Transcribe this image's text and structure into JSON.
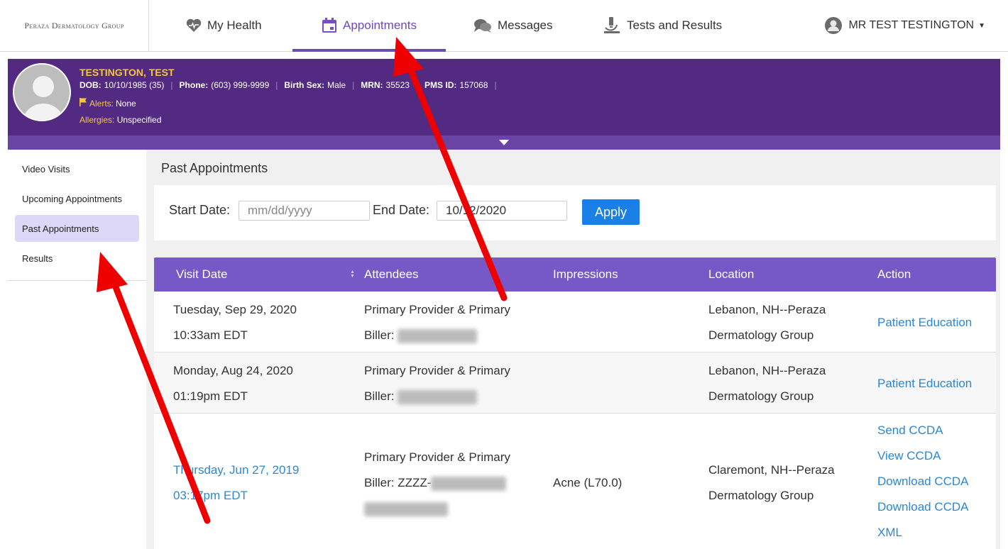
{
  "brand": "Peraza Dermatology Group",
  "nav": {
    "my_health": "My Health",
    "appointments": "Appointments",
    "messages": "Messages",
    "tests_results": "Tests and Results",
    "user": "MR TEST TESTINGTON"
  },
  "patient": {
    "name": "TESTINGTON, TEST",
    "dob_label": "DOB:",
    "dob": "10/10/1985 (35)",
    "phone_label": "Phone:",
    "phone": "(603) 999-9999",
    "sex_label": "Birth Sex:",
    "sex": "Male",
    "mrn_label": "MRN:",
    "mrn": "35523",
    "pms_label": "PMS ID:",
    "pms": "157068",
    "alerts_label": "Alerts:",
    "alerts": "None",
    "allergies_label": "Allergies:",
    "allergies": "Unspecified"
  },
  "sidebar": {
    "items": [
      {
        "label": "Video Visits"
      },
      {
        "label": "Upcoming Appointments"
      },
      {
        "label": "Past Appointments"
      },
      {
        "label": "Results"
      }
    ]
  },
  "main": {
    "title": "Past Appointments",
    "filter": {
      "start_label": "Start Date:",
      "start_placeholder": "mm/dd/yyyy",
      "start_value": "",
      "end_label": "End Date:",
      "end_value": "10/12/2020",
      "apply_label": "Apply"
    },
    "table": {
      "headers": [
        "Visit Date",
        "Attendees",
        "Impressions",
        "Location",
        "Action"
      ],
      "rows": [
        {
          "date": "Tuesday, Sep 29, 2020",
          "time": "10:33am EDT",
          "attendee_line1": "Primary Provider & Primary",
          "attendee_line2": "Biller:",
          "impressions": "",
          "location_line1": "Lebanon, NH--Peraza",
          "location_line2": "Dermatology Group",
          "actions": [
            "Patient Education"
          ]
        },
        {
          "date": "Monday, Aug 24, 2020",
          "time": "01:19pm EDT",
          "attendee_line1": "Primary Provider & Primary",
          "attendee_line2": "Biller:",
          "impressions": "",
          "location_line1": "Lebanon, NH--Peraza",
          "location_line2": "Dermatology Group",
          "actions": [
            "Patient Education"
          ]
        },
        {
          "date": "Thursday, Jun 27, 2019",
          "time": "03:17pm EDT",
          "attendee_line1": "Primary Provider & Primary",
          "attendee_line2": "Biller: ZZZZ-",
          "impressions": "Acne (L70.0)",
          "location_line1": "Claremont, NH--Peraza",
          "location_line2": "Dermatology Group",
          "actions": [
            "Send CCDA",
            "View CCDA",
            "Download CCDA",
            "Download CCDA",
            "XML"
          ]
        }
      ]
    }
  },
  "colors": {
    "brand_purple": "#532a82",
    "header_purple": "#7659c6",
    "accent": "#6d4ab8",
    "link": "#2b87d6",
    "apply": "#1a7fe6",
    "highlight": "#f5c542",
    "arrow": "#ee0000"
  },
  "icons": {
    "my_health": "heart-pulse-icon",
    "appointments": "calendar-icon",
    "messages": "chat-bubbles-icon",
    "tests_results": "microscope-icon",
    "user": "user-avatar-icon",
    "alerts": "flag-icon"
  }
}
